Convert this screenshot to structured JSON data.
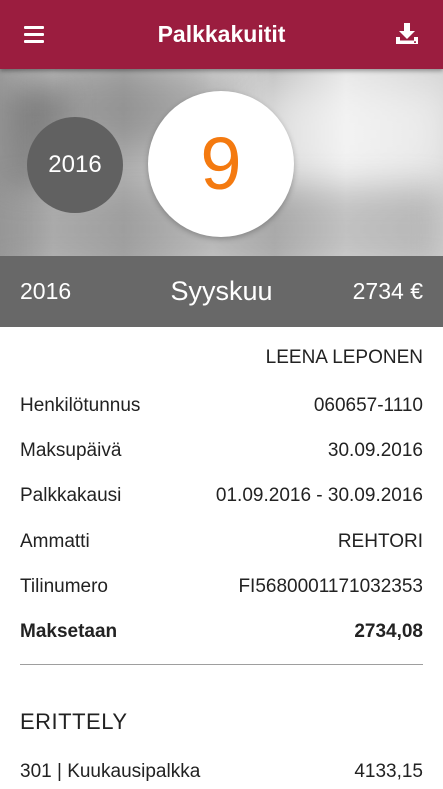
{
  "appbar": {
    "title": "Palkkakuitit",
    "menu_icon": "menu-icon",
    "download_icon": "download-icon"
  },
  "selector": {
    "year": "2016",
    "month_number": "9"
  },
  "summary": {
    "year": "2016",
    "month": "Syyskuu",
    "amount": "2734 €"
  },
  "employee": {
    "name": "LEENA LEPONEN"
  },
  "details": [
    {
      "label": "Henkilötunnus",
      "value": "060657-1110"
    },
    {
      "label": "Maksupäivä",
      "value": "30.09.2016"
    },
    {
      "label": "Palkkakausi",
      "value": "01.09.2016 - 30.09.2016"
    },
    {
      "label": "Ammatti",
      "value": "REHTORI"
    },
    {
      "label": "Tilinumero",
      "value": "FI5680001171032353"
    },
    {
      "label": "Maksetaan",
      "value": "2734,08"
    }
  ],
  "breakdown": {
    "heading": "ERITTELY",
    "items": [
      {
        "label": "301 | Kuukausipalkka",
        "value": "4133,15"
      }
    ]
  },
  "colors": {
    "appbar": "#9b1d3f",
    "accent": "#f47a10",
    "summary_bar": "#686868",
    "year_circle": "#616161"
  }
}
